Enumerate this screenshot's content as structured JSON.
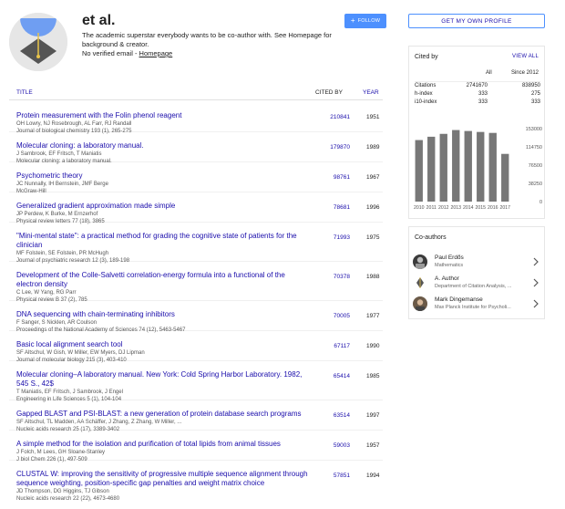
{
  "profile": {
    "name": "et al.",
    "bio": "The academic superstar everybody wants to be co-author with. See Homepage for background & creator.",
    "email_text": "No verified email - ",
    "homepage_label": "Homepage",
    "follow_label": "FOLLOW"
  },
  "get_profile_label": "GET MY OWN PROFILE",
  "table": {
    "col_title": "TITLE",
    "col_cited": "CITED BY",
    "col_year": "YEAR"
  },
  "articles": [
    {
      "title": "Protein measurement with the Folin phenol reagent",
      "authors": "OH Lowry, NJ Rosebrough, AL Farr, RJ Randall",
      "venue": "Journal of biological chemistry 193 (1), 265-275",
      "cited": "210841",
      "year": "1951"
    },
    {
      "title": "Molecular cloning: a laboratory manual.",
      "authors": "J Sambrook, EF Fritsch, T Maniatis",
      "venue": "Molecular cloning: a laboratory manual.",
      "cited": "179870",
      "year": "1989"
    },
    {
      "title": "Psychometric theory",
      "authors": "JC Nunnally, IH Bernstein, JMF Berge",
      "venue": "McGraw-Hill",
      "cited": "98761",
      "year": "1967"
    },
    {
      "title": "Generalized gradient approximation made simple",
      "authors": "JP Perdew, K Burke, M Ernzerhof",
      "venue": "Physical review letters 77 (18), 3865",
      "cited": "78681",
      "year": "1996"
    },
    {
      "title": "\"Mini-mental state\": a practical method for grading the cognitive state of patients for the clinician",
      "authors": "MF Folstein, SE Folstein, PR McHugh",
      "venue": "Journal of psychiatric research 12 (3), 189-198",
      "cited": "71993",
      "year": "1975"
    },
    {
      "title": "Development of the Colle-Salvetti correlation-energy formula into a functional of the electron density",
      "authors": "C Lee, W Yang, RG Parr",
      "venue": "Physical review B 37 (2), 785",
      "cited": "70378",
      "year": "1988"
    },
    {
      "title": "DNA sequencing with chain-terminating inhibitors",
      "authors": "F Sanger, S Nicklen, AR Coulson",
      "venue": "Proceedings of the National Academy of Sciences 74 (12), 5463-5467",
      "cited": "70005",
      "year": "1977"
    },
    {
      "title": "Basic local alignment search tool",
      "authors": "SF Altschul, W Gish, W Miller, EW Myers, DJ Lipman",
      "venue": "Journal of molecular biology 215 (3), 403-410",
      "cited": "67117",
      "year": "1990"
    },
    {
      "title": "Molecular cloning–A laboratory manual. New York: Cold Spring Harbor Laboratory. 1982, 545 S., 42$",
      "authors": "T Maniatis, EF Fritsch, J Sambrook, J Engel",
      "venue": "Engineering in Life Sciences 5 (1), 104-104",
      "cited": "65414",
      "year": "1985"
    },
    {
      "title": "Gapped BLAST and PSI-BLAST: a new generation of protein database search programs",
      "authors": "SF Altschul, TL Madden, AA Schäffer, J Zhang, Z Zhang, W Miller, ...",
      "venue": "Nucleic acids research 25 (17), 3389-3402",
      "cited": "63514",
      "year": "1997"
    },
    {
      "title": "A simple method for the isolation and purification of total lipids from animal tissues",
      "authors": "J Folch, M Lees, GH Sloane-Stanley",
      "venue": "J biol Chem 226 (1), 497-509",
      "cited": "59003",
      "year": "1957"
    },
    {
      "title": "CLUSTAL W: improving the sensitivity of progressive multiple sequence alignment through sequence weighting, position-specific gap penalties and weight matrix choice",
      "authors": "JD Thompson, DG Higgins, TJ Gibson",
      "venue": "Nucleic acids research 22 (22), 4673-4680",
      "cited": "57851",
      "year": "1994"
    }
  ],
  "cited_by": {
    "title": "Cited by",
    "view_all": "VIEW ALL",
    "col_all": "All",
    "col_since": "Since 2012",
    "rows": [
      {
        "label": "Citations",
        "all": "2741670",
        "since": "838950"
      },
      {
        "label": "h-index",
        "all": "333",
        "since": "275"
      },
      {
        "label": "i10-index",
        "all": "333",
        "since": "333"
      }
    ]
  },
  "chart_data": {
    "type": "bar",
    "categories": [
      "2010",
      "2011",
      "2012",
      "2013",
      "2014",
      "2015",
      "2016",
      "2017"
    ],
    "values": [
      129000,
      136000,
      142000,
      150000,
      148000,
      146000,
      144000,
      100000
    ],
    "ylim": [
      0,
      153000
    ],
    "yticks": [
      "153000",
      "114750",
      "76500",
      "38250",
      "0"
    ],
    "grid": false
  },
  "coauthors": {
    "title": "Co-authors",
    "items": [
      {
        "name": "Paul Erdős",
        "affiliation": "Mathematics"
      },
      {
        "name": "A. Author",
        "affiliation": "Department of Citation Analysis, ..."
      },
      {
        "name": "Mark Dingemanse",
        "affiliation": "Max Planck Institute for Psycholi..."
      }
    ]
  },
  "colors": {
    "link": "#1a0dab",
    "accent": "#4d90fe",
    "bar": "#777777"
  }
}
